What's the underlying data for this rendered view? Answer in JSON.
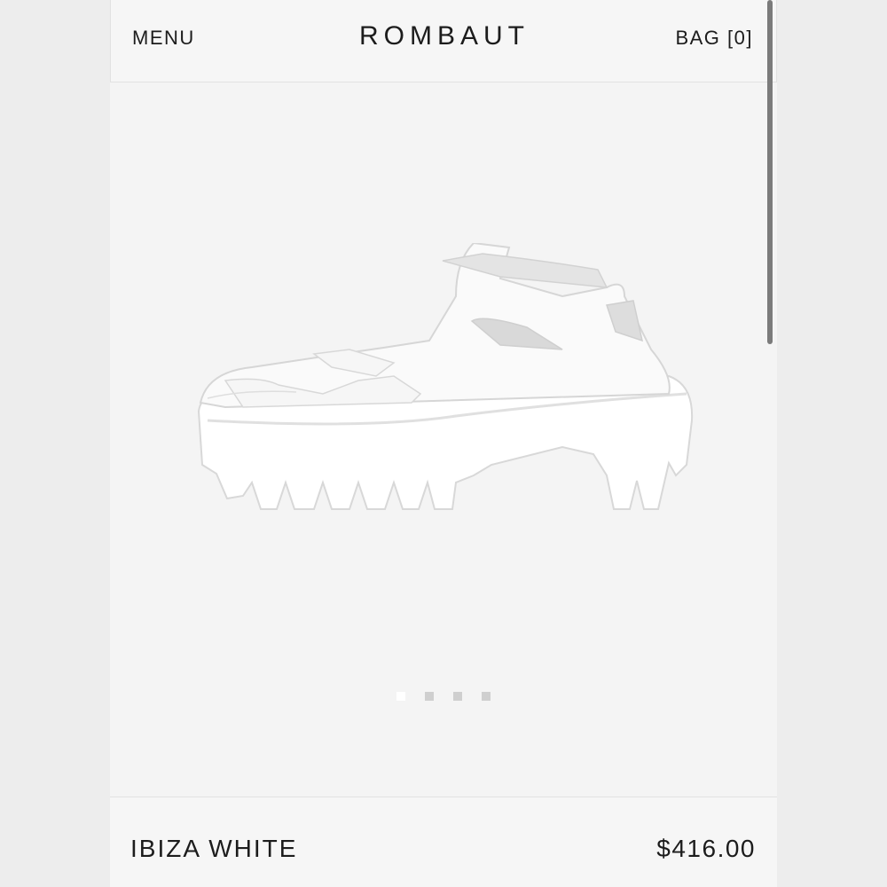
{
  "header": {
    "menu_label": "MENU",
    "brand": "ROMBAUT",
    "bag_label": "BAG [0]"
  },
  "gallery": {
    "image_icon": "white-chunky-shoe-photo",
    "dot_count": 4,
    "active_index": 0
  },
  "product": {
    "name": "IBIZA WHITE",
    "price": "$416.00"
  },
  "colors": {
    "background": "#f4f4f4",
    "text": "#1c1c1c",
    "dot_inactive": "#cfcfcf",
    "dot_active": "#ffffff"
  }
}
